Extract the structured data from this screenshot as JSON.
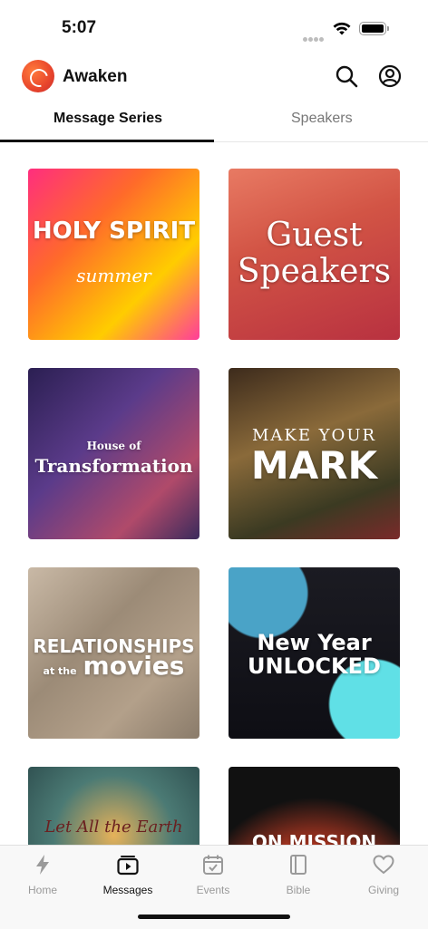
{
  "status_bar": {
    "time": "5:07"
  },
  "app": {
    "name": "Awaken"
  },
  "tabs": [
    {
      "label": "Message Series",
      "active": true
    },
    {
      "label": "Speakers",
      "active": false
    }
  ],
  "series": [
    {
      "title": "HOLY SPIRIT",
      "subtitle": "summer"
    },
    {
      "title": "Guest Speakers"
    },
    {
      "title_small": "House of",
      "title": "Transformation"
    },
    {
      "title_pre": "MAKE YOUR",
      "title": "MARK"
    },
    {
      "title": "RELATIONSHIPS",
      "title_small": "at the",
      "title_big": "movies"
    },
    {
      "title": "New Year",
      "title_sub": "UNLOCKED"
    },
    {
      "title": "Let All the Earth"
    },
    {
      "title": "ON MISSION"
    }
  ],
  "bottom_nav": [
    {
      "label": "Home",
      "icon": "lightning-icon"
    },
    {
      "label": "Messages",
      "icon": "video-icon",
      "active": true
    },
    {
      "label": "Events",
      "icon": "calendar-icon"
    },
    {
      "label": "Bible",
      "icon": "book-icon"
    },
    {
      "label": "Giving",
      "icon": "heart-icon"
    }
  ]
}
